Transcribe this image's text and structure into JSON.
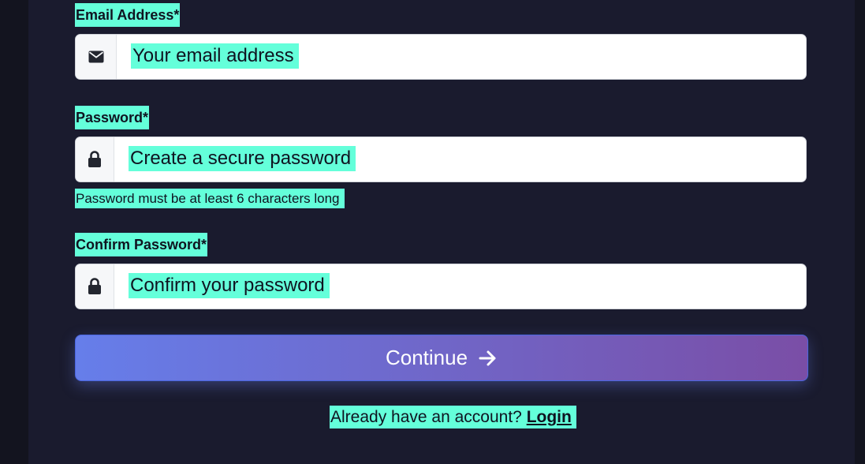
{
  "form": {
    "email": {
      "label": "Email Address*",
      "placeholder": "Your email address",
      "icon": "envelope-icon"
    },
    "password": {
      "label": "Password*",
      "placeholder": "Create a secure password",
      "icon": "lock-icon",
      "hint": "Password must be at least 6 characters long"
    },
    "confirm": {
      "label": "Confirm Password*",
      "placeholder": "Confirm your password",
      "icon": "lock-icon"
    },
    "submit": {
      "label": "Continue",
      "icon": "arrow-right-icon"
    },
    "footer": {
      "text": "Already have an account?",
      "link": "Login"
    }
  },
  "colors": {
    "background": "#13141f",
    "panel": "#1a1b2e",
    "highlight": "#64ffda",
    "button_start": "#667eea",
    "button_end": "#7a4ea6"
  }
}
